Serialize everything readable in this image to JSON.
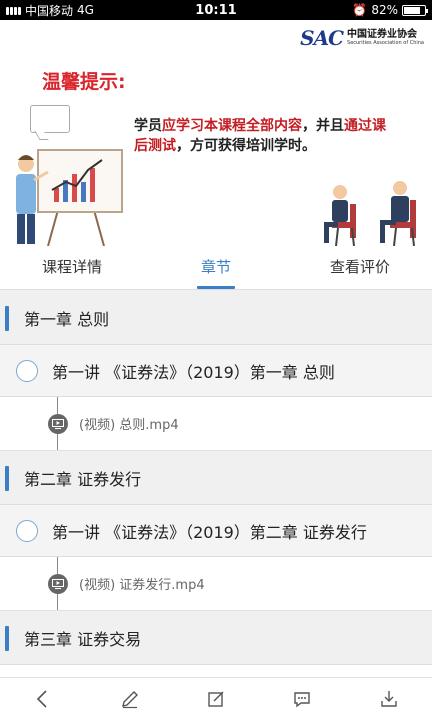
{
  "status_bar": {
    "carrier": "中国移动",
    "network": "4G",
    "time": "10:11",
    "battery_text": "82%",
    "battery_level": 0.82
  },
  "banner": {
    "logo_mark": "SAC",
    "logo_cn": "中国证券业协会",
    "logo_en": "Securities Association of China",
    "tip_title": "温馨提示:",
    "tip_parts": [
      {
        "text": "学员",
        "emph": false
      },
      {
        "text": "应学习本课程全部内容",
        "emph": true
      },
      {
        "text": "，并且",
        "emph": false
      },
      {
        "text": "通过课后测试",
        "emph": true
      },
      {
        "text": "，方可获得培训学时。",
        "emph": false
      }
    ]
  },
  "tabs": [
    {
      "label": "课程详情",
      "active": false
    },
    {
      "label": "章节",
      "active": true
    },
    {
      "label": "查看评价",
      "active": false
    }
  ],
  "list": [
    {
      "kind": "chapter",
      "title": "第一章  总则"
    },
    {
      "kind": "lecture",
      "title": "第一讲 《证券法》（2019）第一章 总则"
    },
    {
      "kind": "media",
      "title": "(视频) 总则.mp4"
    },
    {
      "kind": "chapter",
      "title": "第二章  证券发行"
    },
    {
      "kind": "lecture",
      "title": "第一讲 《证券法》（2019）第二章 证券发行"
    },
    {
      "kind": "media",
      "title": "(视频) 证券发行.mp4"
    },
    {
      "kind": "chapter",
      "title": "第三章  证券交易"
    }
  ],
  "toolbar": [
    {
      "name": "back-icon"
    },
    {
      "name": "pen-icon"
    },
    {
      "name": "edit-note-icon"
    },
    {
      "name": "comment-icon"
    },
    {
      "name": "download-icon"
    }
  ],
  "colors": {
    "accent": "#3b7fc4",
    "tip_red": "#d9252b",
    "chapter_bg": "#f0f0f0",
    "lecture_bg": "#f4f4f4"
  }
}
